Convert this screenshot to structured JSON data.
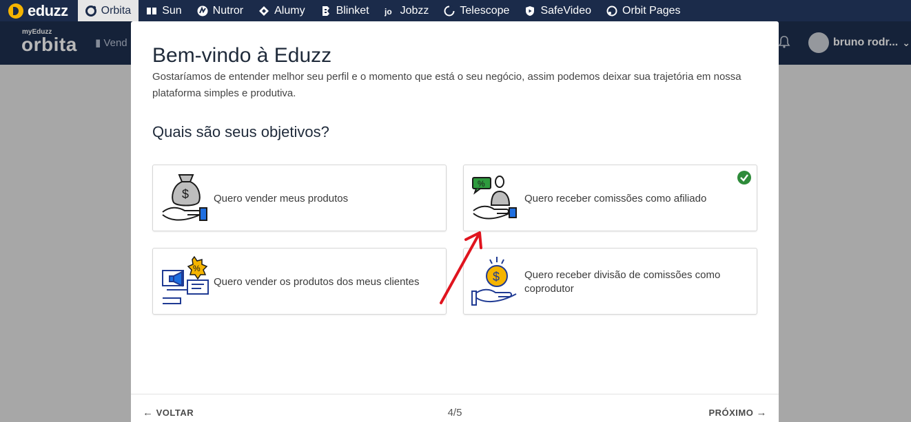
{
  "topbar": {
    "logo_text": "eduzz",
    "products": [
      {
        "label": "Orbita",
        "icon": "orbita-icon",
        "active": true
      },
      {
        "label": "Sun",
        "icon": "sun-icon",
        "active": false
      },
      {
        "label": "Nutror",
        "icon": "nutror-icon",
        "active": false
      },
      {
        "label": "Alumy",
        "icon": "alumy-icon",
        "active": false
      },
      {
        "label": "Blinket",
        "icon": "blinket-icon",
        "active": false
      },
      {
        "label": "Jobzz",
        "icon": "jobzz-icon",
        "active": false
      },
      {
        "label": "Telescope",
        "icon": "telescope-icon",
        "active": false
      },
      {
        "label": "SafeVideo",
        "icon": "safevideo-icon",
        "active": false
      },
      {
        "label": "Orbit Pages",
        "icon": "orbit-pages-icon",
        "active": false
      }
    ]
  },
  "appbar": {
    "brand_small": "myEduzz",
    "brand_big": "orbita",
    "nav_partial": "Vend",
    "user_name": "bruno rodr...",
    "user_chevron": "⌄"
  },
  "modal": {
    "title": "Bem-vindo à Eduzz",
    "intro": "Gostaríamos de entender melhor seu perfil e o momento que está o seu negócio, assim podemos deixar sua trajetória em nossa plataforma simples e produtiva.",
    "question": "Quais são seus objetivos?",
    "options": [
      {
        "label": "Quero vender meus produtos",
        "icon": "money-bag-hand-icon",
        "selected": false
      },
      {
        "label": "Quero receber comissões como afiliado",
        "icon": "affiliate-commission-icon",
        "selected": true
      },
      {
        "label": "Quero vender os produtos dos meus clientes",
        "icon": "promotion-sale-icon",
        "selected": false
      },
      {
        "label": "Quero receber divisão de comissões como coprodutor",
        "icon": "coin-hand-icon",
        "selected": false
      }
    ],
    "footer": {
      "back_label": "VOLTAR",
      "back_arrow": "←",
      "step": "4/5",
      "next_label": "PRÓXIMO",
      "next_arrow": "→"
    }
  },
  "colors": {
    "topbar": "#1b2b4a",
    "appbar": "#1e3050",
    "selected_check": "#2e8b3a",
    "annotation_arrow": "#e0141e"
  }
}
